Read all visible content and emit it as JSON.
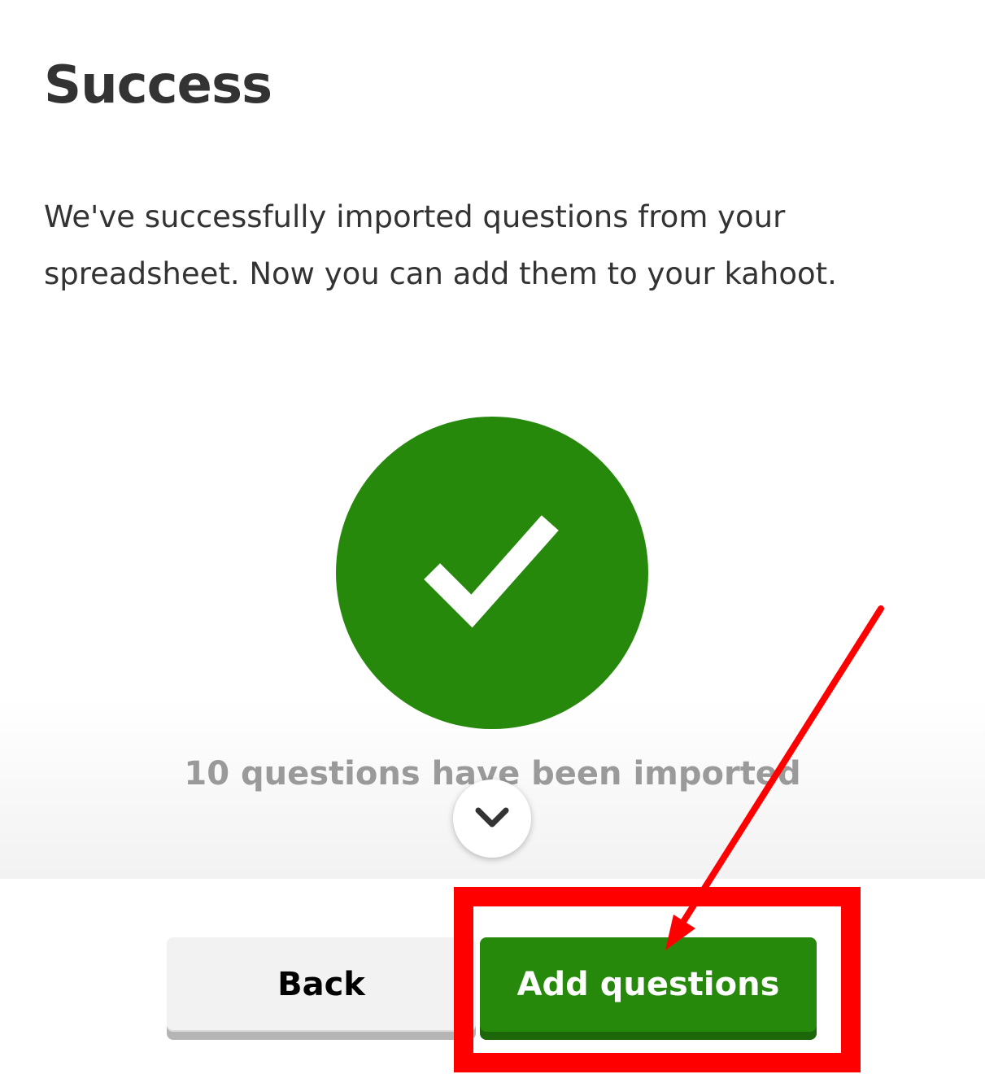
{
  "title": "Success",
  "description": "We've successfully imported questions from your spreadsheet. Now you can add them to your kahoot.",
  "status_icon": "check-icon",
  "imported_count_text": "10 questions have been imported",
  "scroll_icon": "chevron-down-icon",
  "buttons": {
    "back_label": "Back",
    "add_label": "Add questions"
  },
  "colors": {
    "success_green": "#26890c",
    "annotation_red": "#ff0000"
  }
}
